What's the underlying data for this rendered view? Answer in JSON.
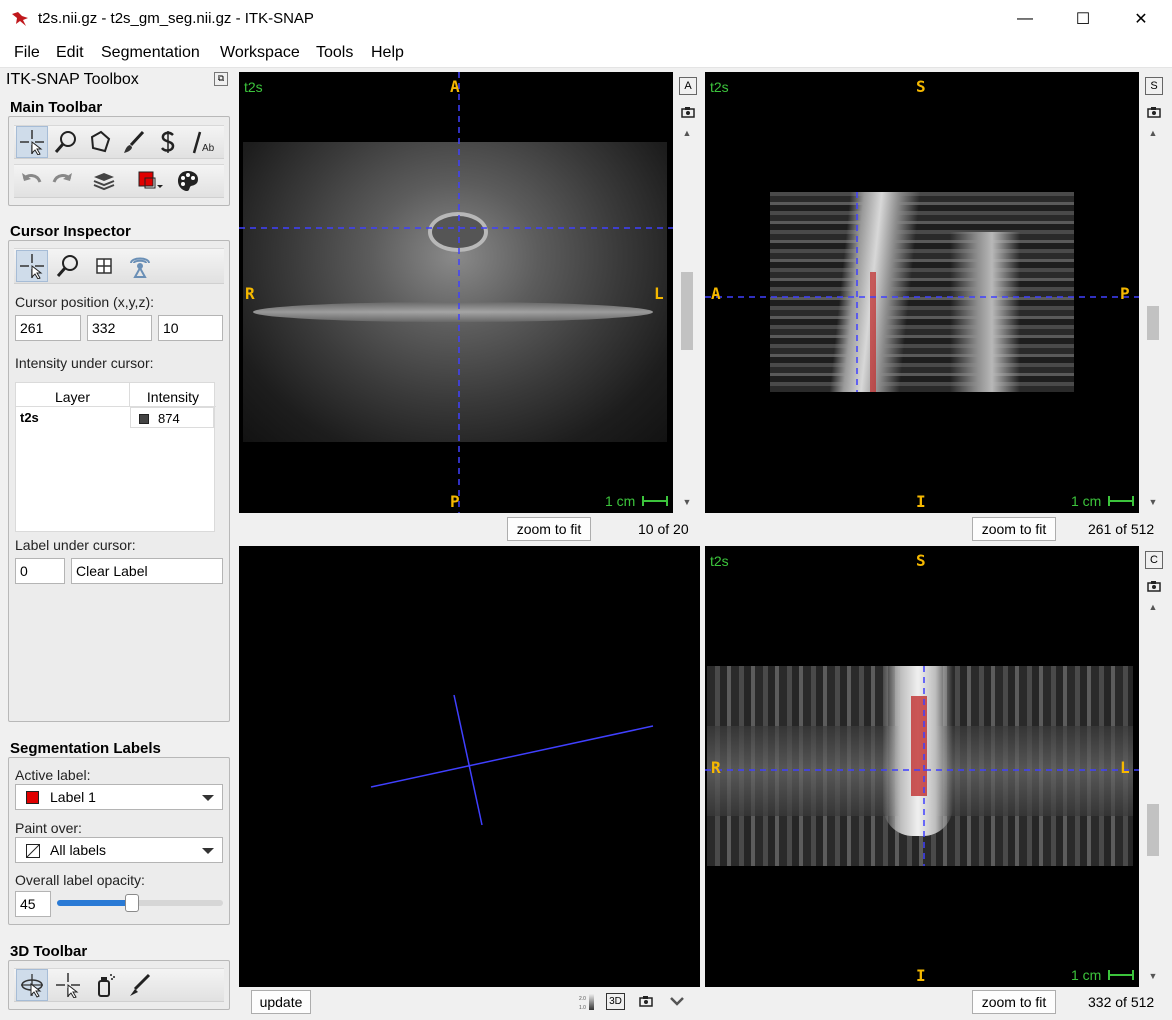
{
  "window": {
    "title": "t2s.nii.gz - t2s_gm_seg.nii.gz - ITK-SNAP",
    "minimize": "—",
    "maximize": "☐",
    "close": "✕"
  },
  "menu": [
    "File",
    "Edit",
    "Segmentation",
    "Workspace",
    "Tools",
    "Help"
  ],
  "toolbox": {
    "title": "ITK-SNAP Toolbox",
    "main_toolbar": "Main Toolbar",
    "cursor_inspector": {
      "title": "Cursor Inspector",
      "position_label": "Cursor position (x,y,z):",
      "x": "261",
      "y": "332",
      "z": "10",
      "intensity_label": "Intensity under cursor:",
      "columns": [
        "Layer",
        "Intensity"
      ],
      "rows": [
        {
          "layer": "t2s",
          "intensity": "874"
        }
      ],
      "label_under_cursor": "Label under cursor:",
      "label_value": "0",
      "label_name": "Clear Label"
    },
    "segmentation_labels": {
      "title": "Segmentation Labels",
      "active_label_caption": "Active label:",
      "active_label": "Label 1",
      "active_label_color": "#e00000",
      "paint_over_caption": "Paint over:",
      "paint_over": "All labels",
      "opacity_caption": "Overall label opacity:",
      "opacity_value": "45",
      "opacity_fraction": 0.45
    },
    "toolbar_3d": "3D Toolbar"
  },
  "views": {
    "axial": {
      "layer": "t2s",
      "top": "A",
      "bottom": "P",
      "left": "R",
      "right": "L",
      "scale": "1 cm",
      "side_tag": "A",
      "zoom": "zoom to fit",
      "slice": "10 of 20"
    },
    "sagittal": {
      "layer": "t2s",
      "top": "S",
      "bottom": "I",
      "left": "A",
      "right": "P",
      "scale": "1 cm",
      "side_tag": "S",
      "zoom": "zoom to fit",
      "slice": "261 of 512"
    },
    "three_d": {
      "update": "update",
      "view_3d": "3D"
    },
    "coronal": {
      "layer": "t2s",
      "top": "S",
      "bottom": "I",
      "left": "R",
      "right": "L",
      "scale": "1 cm",
      "side_tag": "C",
      "zoom": "zoom to fit",
      "slice": "332 of 512"
    }
  },
  "colors": {
    "cursor": "#4040ff",
    "orientation": "#f5b800",
    "layer_name": "#3cc43c",
    "seg": "#d02020"
  }
}
